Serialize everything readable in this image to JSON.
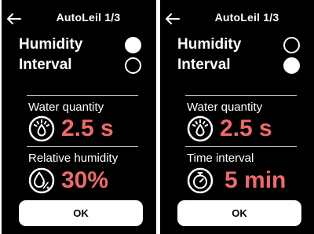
{
  "screens": [
    {
      "title": "AutoLeil 1/3",
      "options": [
        {
          "label": "Humidity",
          "selected": true
        },
        {
          "label": "Interval",
          "selected": false
        }
      ],
      "sections": [
        {
          "label": "Water quantity",
          "value": "2.5 s",
          "icon": "water-spray-icon"
        },
        {
          "label": "Relative humidity",
          "value": "30%",
          "icon": "humidity-percent-icon"
        }
      ],
      "ok_label": "OK"
    },
    {
      "title": "AutoLeil 1/3",
      "options": [
        {
          "label": "Humidity",
          "selected": false
        },
        {
          "label": "Interval",
          "selected": true
        }
      ],
      "sections": [
        {
          "label": "Water quantity",
          "value": "2.5 s",
          "icon": "water-spray-icon"
        },
        {
          "label": "Time interval",
          "value": "5 min",
          "icon": "timer-icon"
        }
      ],
      "ok_label": "OK"
    }
  ],
  "colors": {
    "background": "#000000",
    "text": "#ffffff",
    "value_accent": "#ee6a6a",
    "button": "#ffffff"
  }
}
